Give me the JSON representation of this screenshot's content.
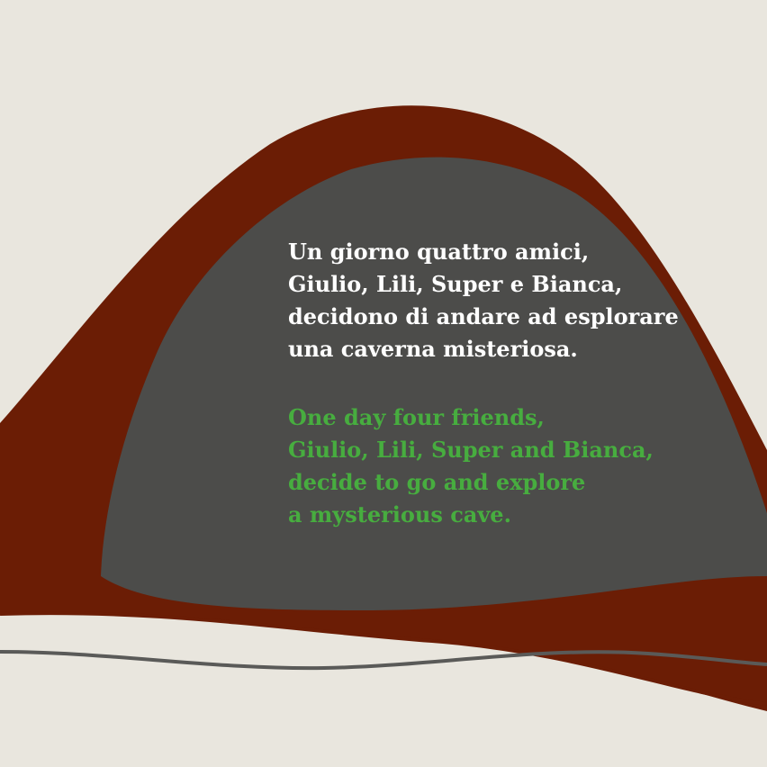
{
  "colors": {
    "background": "#e9e6de",
    "mountain": "#6b1d05",
    "cave": "#4c4c4a",
    "italian_text": "#ffffff",
    "english_text": "#47ad3f",
    "dark_wave": "#5a5a58",
    "red_wave": "#6b1d05"
  },
  "italian_text": {
    "lines": [
      "Un giorno quattro amici,",
      "Giulio, Lili, Super e Bianca,",
      "decidono di andare ad esplorare",
      "una caverna misteriosa."
    ]
  },
  "english_text": {
    "lines": [
      "One day four friends,",
      "Giulio, Lili, Super and Bianca,",
      "decide to go and explore",
      "a mysterious cave."
    ]
  }
}
